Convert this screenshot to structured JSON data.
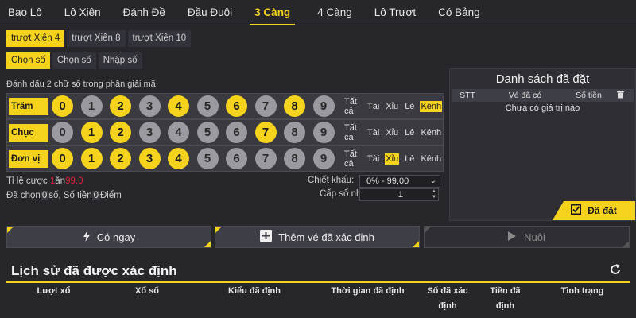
{
  "top_tabs": [
    "Bao Lô",
    "Lô Xiên",
    "Đánh Đề",
    "Đầu Đuôi",
    "3 Càng",
    "4 Càng",
    "Lô Trượt",
    "Có Bảng"
  ],
  "sub_tabs": [
    "trượt Xiên 4",
    "trượt Xiên 8",
    "trượt Xiên 10"
  ],
  "mode_tabs": [
    "Chọn số",
    "Chọn số",
    "Nhập số"
  ],
  "hint": "Đánh dấu 2 chữ số trong phần giải mã",
  "rows": [
    {
      "label": "Trăm",
      "balls": [
        "0",
        "1",
        "2",
        "3",
        "4",
        "5",
        "6",
        "7",
        "8",
        "9"
      ],
      "tatca": "Tất cả",
      "opts": [
        "Tài",
        "Xỉu",
        "Lẻ",
        "Kênh"
      ]
    },
    {
      "label": "Chục",
      "balls": [
        "0",
        "1",
        "2",
        "3",
        "4",
        "5",
        "6",
        "7",
        "8",
        "9"
      ],
      "tatca": "Tất cả",
      "opts": [
        "Tài",
        "Xỉu",
        "Lẻ",
        "Kênh"
      ]
    },
    {
      "label": "Đơn vị",
      "balls": [
        "0",
        "1",
        "2",
        "3",
        "4",
        "5",
        "6",
        "7",
        "8",
        "9"
      ],
      "tatca": "Tất cả",
      "opts": [
        "Tài",
        "Xỉu",
        "Lẻ",
        "Kênh"
      ]
    }
  ],
  "rate": {
    "label": "Tỉ lệ cược",
    "value": "1",
    "mid": "ăn",
    "payout": "99.0"
  },
  "picked": {
    "prefix": "Đã chọn",
    "count": "0",
    "mid": "số, Số tiền",
    "amount": "0",
    "suffix": "Điểm"
  },
  "discount": {
    "label": "Chiết khấu:",
    "value": "0% - 99,00"
  },
  "multiplier": {
    "label": "Cấp số nhân:",
    "value": "1"
  },
  "panel": {
    "title": "Danh sách đã đặt",
    "columns": [
      "STT",
      "Vé đã có",
      "Số tiền"
    ],
    "empty": "Chưa có giá trị nào",
    "submit": "Đã đặt"
  },
  "actions": {
    "quick": "Có ngay",
    "add": "Thêm vé đã xác định",
    "nurture": "Nuôi"
  },
  "history": {
    "title": "Lịch sử đã được xác định",
    "columns": [
      "Lượt xổ",
      "Xổ số",
      "Kiểu đã định",
      "Thời gian đã định",
      "Số đã xác định",
      "Tiền đã định",
      "Tình trạng"
    ]
  },
  "colors": {
    "accent": "#f5d21c",
    "bg": "#26262b",
    "danger": "#e0203a"
  },
  "icons": {
    "quick": "lightning-icon",
    "add": "plus-square-icon",
    "nurture": "play-icon",
    "refresh": "refresh-icon",
    "check": "check-square-icon",
    "trash": "trash-icon"
  }
}
